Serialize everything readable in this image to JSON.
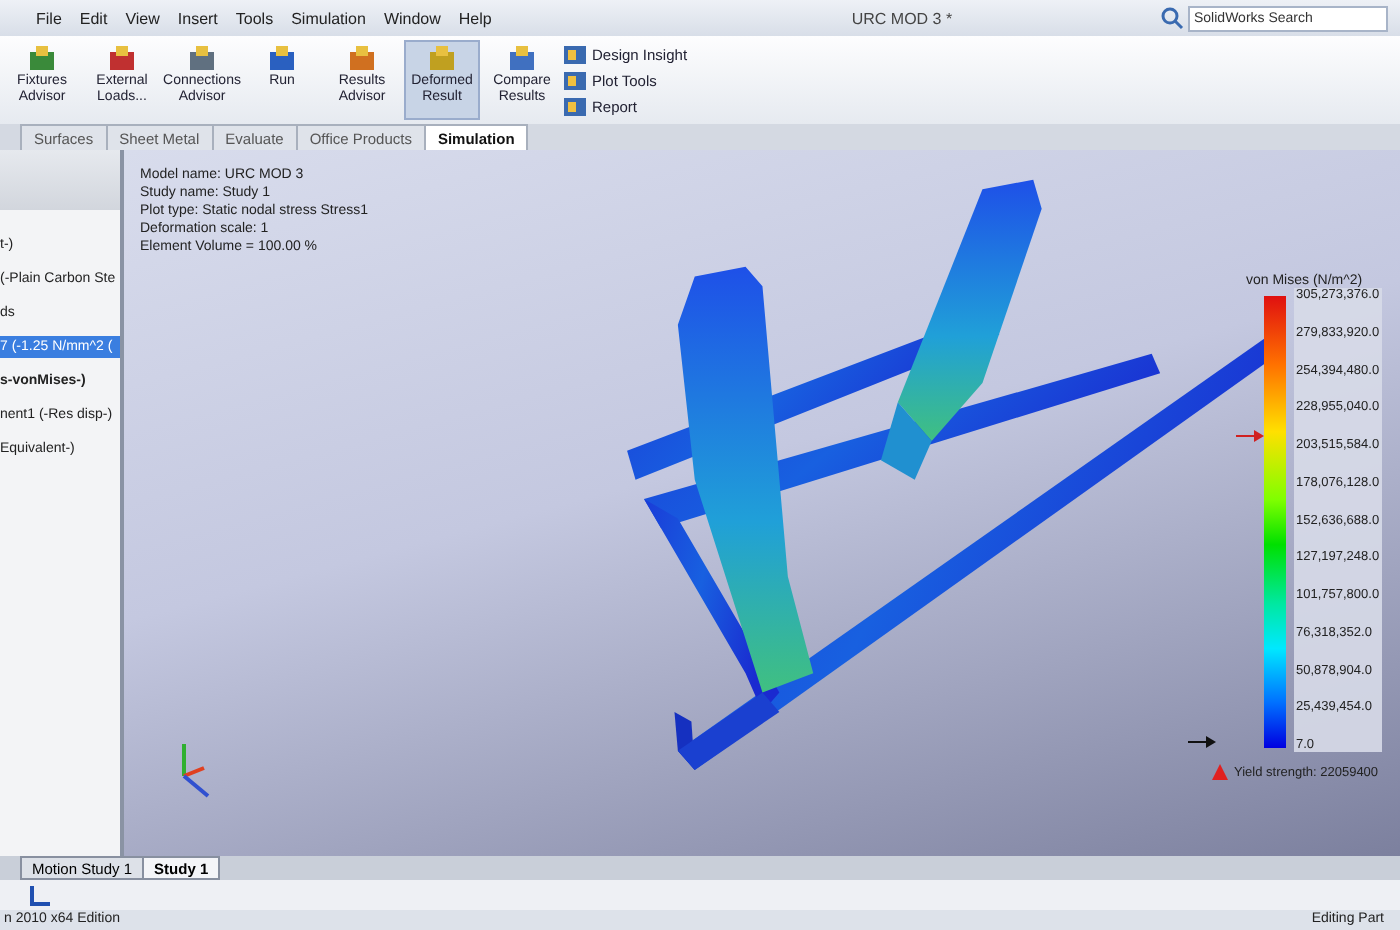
{
  "menu": [
    "File",
    "Edit",
    "View",
    "Insert",
    "Tools",
    "Simulation",
    "Window",
    "Help"
  ],
  "window": {
    "title": "URC MOD 3 *"
  },
  "search": {
    "placeholder": "SolidWorks Search"
  },
  "ribbon": {
    "buttons": [
      {
        "label": "Fixtures Advisor",
        "selected": false
      },
      {
        "label": "External Loads...",
        "selected": false
      },
      {
        "label": "Connections Advisor",
        "selected": false
      },
      {
        "label": "Run",
        "selected": false
      },
      {
        "label": "Results Advisor",
        "selected": false
      },
      {
        "label": "Deformed Result",
        "selected": true
      },
      {
        "label": "Compare Results",
        "selected": false
      }
    ],
    "small_buttons": [
      "Design Insight",
      "Plot Tools",
      "Report"
    ]
  },
  "tabs": [
    {
      "label": "Surfaces",
      "selected": false
    },
    {
      "label": "Sheet Metal",
      "selected": false
    },
    {
      "label": "Evaluate",
      "selected": false
    },
    {
      "label": "Office Products",
      "selected": false
    },
    {
      "label": "Simulation",
      "selected": true
    }
  ],
  "tree": [
    {
      "label": "t-)",
      "bold": false,
      "selected": false
    },
    {
      "label": "(-Plain Carbon Ste",
      "bold": false,
      "selected": false
    },
    {
      "label": "ds",
      "bold": false,
      "selected": false
    },
    {
      "label": "7 (-1.25 N/mm^2 (",
      "bold": false,
      "selected": true
    },
    {
      "label": "s-vonMises-)",
      "bold": true,
      "selected": false
    },
    {
      "label": "nent1 (-Res disp-)",
      "bold": false,
      "selected": false
    },
    {
      "label": "Equivalent-)",
      "bold": false,
      "selected": false
    }
  ],
  "plot_info": [
    "Model name: URC MOD 3",
    "Study name: Study 1",
    "Plot type: Static nodal stress Stress1",
    "Deformation scale: 1",
    "Element Volume = 100.00 %"
  ],
  "legend": {
    "title": "von Mises (N/m^2)",
    "labels": [
      "305,273,376.0",
      "279,833,920.0",
      "254,394,480.0",
      "228,955,040.0",
      "203,515,584.0",
      "178,076,128.0",
      "152,636,688.0",
      "127,197,248.0",
      "101,757,800.0",
      "76,318,352.0",
      "50,878,904.0",
      "25,439,454.0",
      "7.0"
    ],
    "yield": "Yield strength: 22059400"
  },
  "bottom_tabs": [
    {
      "label": "Motion Study 1",
      "selected": false
    },
    {
      "label": "Study 1",
      "selected": true
    }
  ],
  "status_bar": {
    "left": "n 2010 x64 Edition",
    "right": "Editing Part"
  }
}
